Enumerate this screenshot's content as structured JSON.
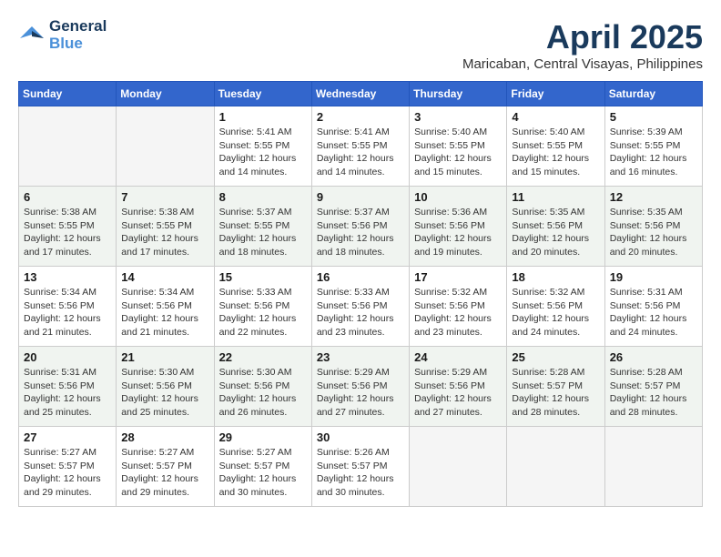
{
  "logo": {
    "line1": "General",
    "line2": "Blue"
  },
  "title": "April 2025",
  "location": "Maricaban, Central Visayas, Philippines",
  "days_of_week": [
    "Sunday",
    "Monday",
    "Tuesday",
    "Wednesday",
    "Thursday",
    "Friday",
    "Saturday"
  ],
  "weeks": [
    [
      {
        "num": "",
        "sunrise": "",
        "sunset": "",
        "daylight": ""
      },
      {
        "num": "",
        "sunrise": "",
        "sunset": "",
        "daylight": ""
      },
      {
        "num": "1",
        "sunrise": "Sunrise: 5:41 AM",
        "sunset": "Sunset: 5:55 PM",
        "daylight": "Daylight: 12 hours and 14 minutes."
      },
      {
        "num": "2",
        "sunrise": "Sunrise: 5:41 AM",
        "sunset": "Sunset: 5:55 PM",
        "daylight": "Daylight: 12 hours and 14 minutes."
      },
      {
        "num": "3",
        "sunrise": "Sunrise: 5:40 AM",
        "sunset": "Sunset: 5:55 PM",
        "daylight": "Daylight: 12 hours and 15 minutes."
      },
      {
        "num": "4",
        "sunrise": "Sunrise: 5:40 AM",
        "sunset": "Sunset: 5:55 PM",
        "daylight": "Daylight: 12 hours and 15 minutes."
      },
      {
        "num": "5",
        "sunrise": "Sunrise: 5:39 AM",
        "sunset": "Sunset: 5:55 PM",
        "daylight": "Daylight: 12 hours and 16 minutes."
      }
    ],
    [
      {
        "num": "6",
        "sunrise": "Sunrise: 5:38 AM",
        "sunset": "Sunset: 5:55 PM",
        "daylight": "Daylight: 12 hours and 17 minutes."
      },
      {
        "num": "7",
        "sunrise": "Sunrise: 5:38 AM",
        "sunset": "Sunset: 5:55 PM",
        "daylight": "Daylight: 12 hours and 17 minutes."
      },
      {
        "num": "8",
        "sunrise": "Sunrise: 5:37 AM",
        "sunset": "Sunset: 5:55 PM",
        "daylight": "Daylight: 12 hours and 18 minutes."
      },
      {
        "num": "9",
        "sunrise": "Sunrise: 5:37 AM",
        "sunset": "Sunset: 5:56 PM",
        "daylight": "Daylight: 12 hours and 18 minutes."
      },
      {
        "num": "10",
        "sunrise": "Sunrise: 5:36 AM",
        "sunset": "Sunset: 5:56 PM",
        "daylight": "Daylight: 12 hours and 19 minutes."
      },
      {
        "num": "11",
        "sunrise": "Sunrise: 5:35 AM",
        "sunset": "Sunset: 5:56 PM",
        "daylight": "Daylight: 12 hours and 20 minutes."
      },
      {
        "num": "12",
        "sunrise": "Sunrise: 5:35 AM",
        "sunset": "Sunset: 5:56 PM",
        "daylight": "Daylight: 12 hours and 20 minutes."
      }
    ],
    [
      {
        "num": "13",
        "sunrise": "Sunrise: 5:34 AM",
        "sunset": "Sunset: 5:56 PM",
        "daylight": "Daylight: 12 hours and 21 minutes."
      },
      {
        "num": "14",
        "sunrise": "Sunrise: 5:34 AM",
        "sunset": "Sunset: 5:56 PM",
        "daylight": "Daylight: 12 hours and 21 minutes."
      },
      {
        "num": "15",
        "sunrise": "Sunrise: 5:33 AM",
        "sunset": "Sunset: 5:56 PM",
        "daylight": "Daylight: 12 hours and 22 minutes."
      },
      {
        "num": "16",
        "sunrise": "Sunrise: 5:33 AM",
        "sunset": "Sunset: 5:56 PM",
        "daylight": "Daylight: 12 hours and 23 minutes."
      },
      {
        "num": "17",
        "sunrise": "Sunrise: 5:32 AM",
        "sunset": "Sunset: 5:56 PM",
        "daylight": "Daylight: 12 hours and 23 minutes."
      },
      {
        "num": "18",
        "sunrise": "Sunrise: 5:32 AM",
        "sunset": "Sunset: 5:56 PM",
        "daylight": "Daylight: 12 hours and 24 minutes."
      },
      {
        "num": "19",
        "sunrise": "Sunrise: 5:31 AM",
        "sunset": "Sunset: 5:56 PM",
        "daylight": "Daylight: 12 hours and 24 minutes."
      }
    ],
    [
      {
        "num": "20",
        "sunrise": "Sunrise: 5:31 AM",
        "sunset": "Sunset: 5:56 PM",
        "daylight": "Daylight: 12 hours and 25 minutes."
      },
      {
        "num": "21",
        "sunrise": "Sunrise: 5:30 AM",
        "sunset": "Sunset: 5:56 PM",
        "daylight": "Daylight: 12 hours and 25 minutes."
      },
      {
        "num": "22",
        "sunrise": "Sunrise: 5:30 AM",
        "sunset": "Sunset: 5:56 PM",
        "daylight": "Daylight: 12 hours and 26 minutes."
      },
      {
        "num": "23",
        "sunrise": "Sunrise: 5:29 AM",
        "sunset": "Sunset: 5:56 PM",
        "daylight": "Daylight: 12 hours and 27 minutes."
      },
      {
        "num": "24",
        "sunrise": "Sunrise: 5:29 AM",
        "sunset": "Sunset: 5:56 PM",
        "daylight": "Daylight: 12 hours and 27 minutes."
      },
      {
        "num": "25",
        "sunrise": "Sunrise: 5:28 AM",
        "sunset": "Sunset: 5:57 PM",
        "daylight": "Daylight: 12 hours and 28 minutes."
      },
      {
        "num": "26",
        "sunrise": "Sunrise: 5:28 AM",
        "sunset": "Sunset: 5:57 PM",
        "daylight": "Daylight: 12 hours and 28 minutes."
      }
    ],
    [
      {
        "num": "27",
        "sunrise": "Sunrise: 5:27 AM",
        "sunset": "Sunset: 5:57 PM",
        "daylight": "Daylight: 12 hours and 29 minutes."
      },
      {
        "num": "28",
        "sunrise": "Sunrise: 5:27 AM",
        "sunset": "Sunset: 5:57 PM",
        "daylight": "Daylight: 12 hours and 29 minutes."
      },
      {
        "num": "29",
        "sunrise": "Sunrise: 5:27 AM",
        "sunset": "Sunset: 5:57 PM",
        "daylight": "Daylight: 12 hours and 30 minutes."
      },
      {
        "num": "30",
        "sunrise": "Sunrise: 5:26 AM",
        "sunset": "Sunset: 5:57 PM",
        "daylight": "Daylight: 12 hours and 30 minutes."
      },
      {
        "num": "",
        "sunrise": "",
        "sunset": "",
        "daylight": ""
      },
      {
        "num": "",
        "sunrise": "",
        "sunset": "",
        "daylight": ""
      },
      {
        "num": "",
        "sunrise": "",
        "sunset": "",
        "daylight": ""
      }
    ]
  ]
}
